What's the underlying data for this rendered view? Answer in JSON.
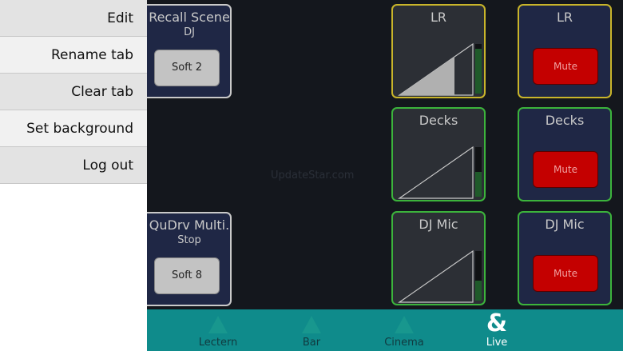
{
  "menu": {
    "items": [
      {
        "label": "Edit"
      },
      {
        "label": "Rename tab"
      },
      {
        "label": "Clear tab"
      },
      {
        "label": "Set background"
      },
      {
        "label": "Log out"
      }
    ]
  },
  "scene_tile": {
    "title": "Recall Scene",
    "sub": "DJ",
    "button": "Soft 2"
  },
  "drive_tile": {
    "title": "QuDrv Multi.",
    "sub": "Stop",
    "button": "Soft 8"
  },
  "faders": [
    {
      "label": "LR",
      "level": 0.75,
      "meter": 0.9
    },
    {
      "label": "Decks",
      "level": 0.75,
      "meter": 0.5
    },
    {
      "label": "DJ Mic",
      "level": 0.75,
      "meter": 0.4
    }
  ],
  "mutes": [
    {
      "label": "LR",
      "button": "Mute"
    },
    {
      "label": "Decks",
      "button": "Mute"
    },
    {
      "label": "DJ Mic",
      "button": "Mute"
    }
  ],
  "watermark": "UpdateStar.com",
  "tabs": [
    {
      "label": "Lectern",
      "icon": "lectern-icon"
    },
    {
      "label": "Bar",
      "icon": "bar-icon"
    },
    {
      "label": "Cinema",
      "icon": "cinema-icon"
    },
    {
      "label": "Live",
      "icon": "ampersand-icon",
      "glyph": "&"
    }
  ],
  "colors": {
    "panel_bg": "#14171d",
    "tile_bg": "#1f2745",
    "mute_red": "#c40000",
    "fader_border_green": "#3cb43c",
    "fader_border_yellow": "#c9b52a",
    "tabbar": "#0f8b8b"
  }
}
